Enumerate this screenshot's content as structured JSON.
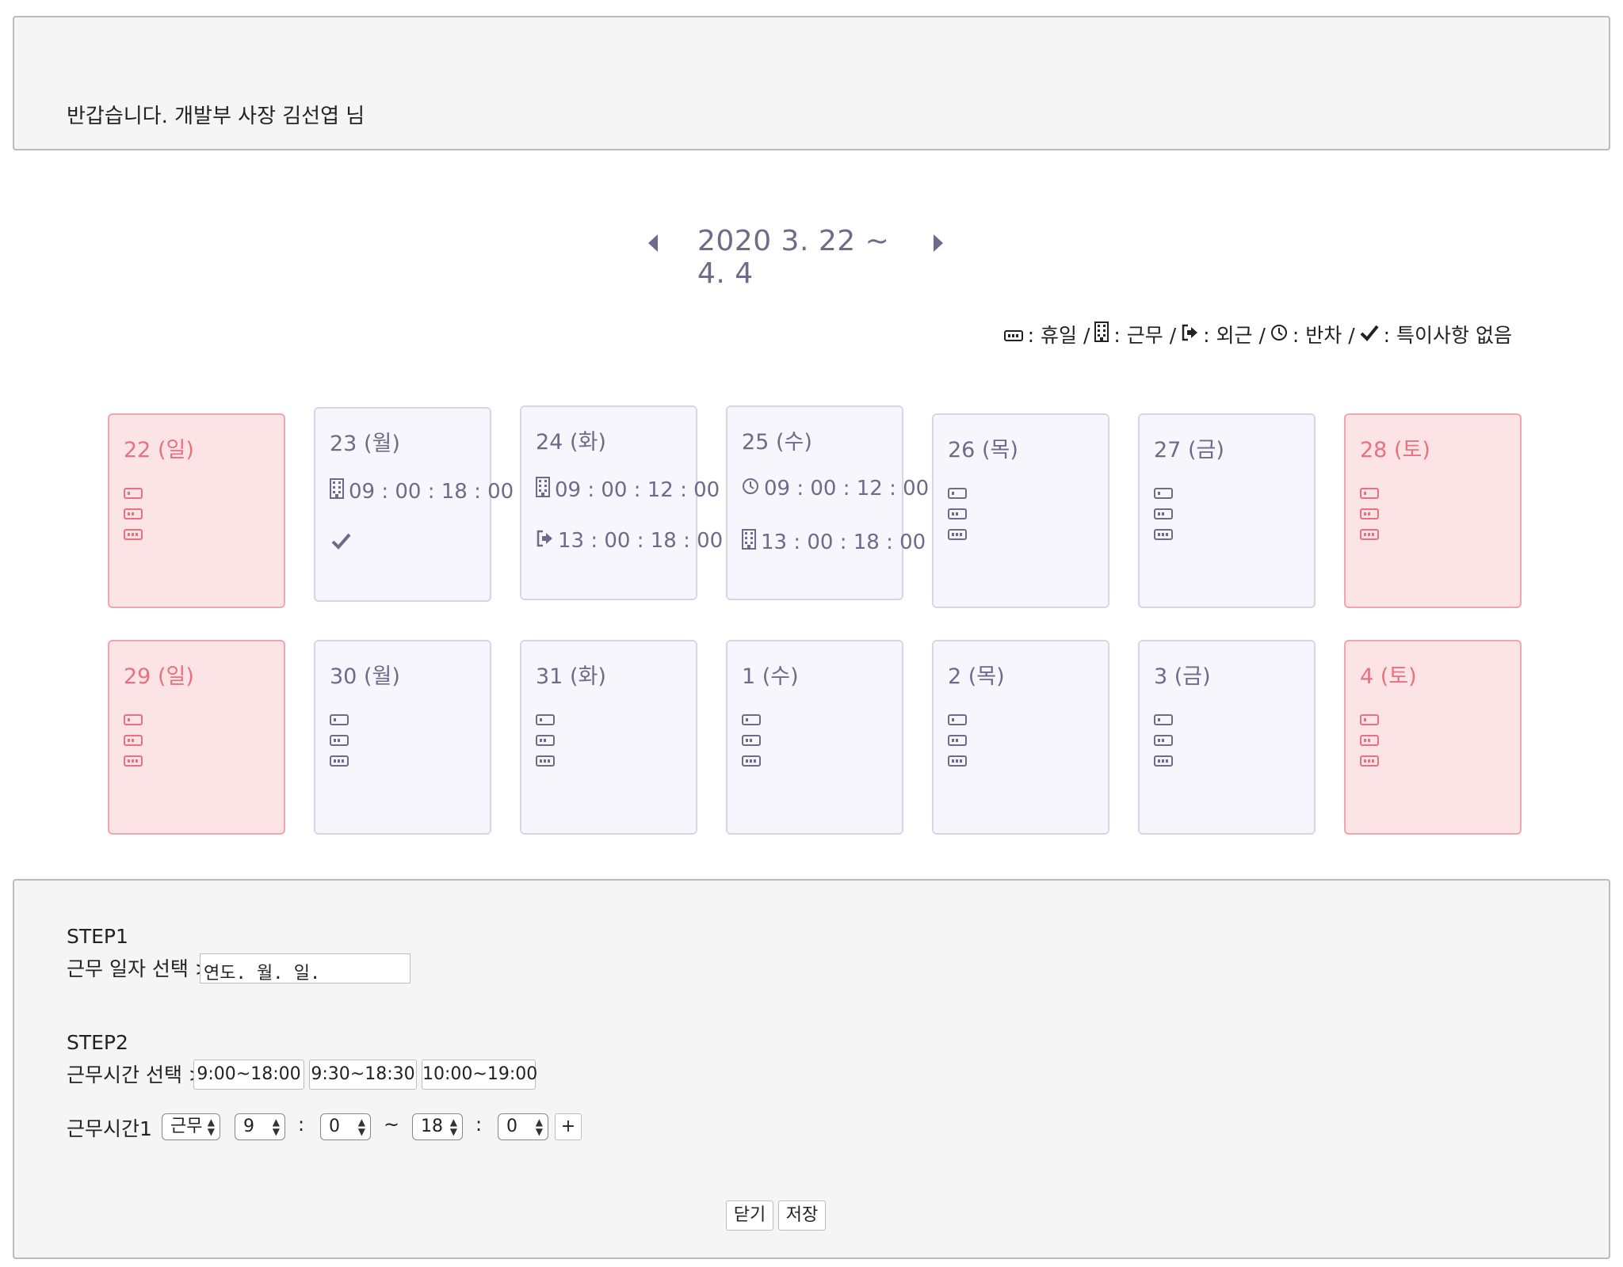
{
  "header": {
    "greeting": "반갑습니다. 개발부 사장 김선엽 님"
  },
  "nav": {
    "range": "2020 3. 22 ~ 4. 4"
  },
  "legend": {
    "items": [
      {
        "icon": "rest-icon",
        "label": ": 휴일 /"
      },
      {
        "icon": "building-icon",
        "label": ": 근무 /"
      },
      {
        "icon": "exit-icon",
        "label": ": 외근 /"
      },
      {
        "icon": "clock-icon",
        "label": ": 반차 /"
      },
      {
        "icon": "check-icon",
        "label": ": 특이사항 없음"
      }
    ]
  },
  "calendar": {
    "week1": [
      {
        "date": "22 (일)",
        "weekend": true
      },
      {
        "date": "23 (월)",
        "weekend": false,
        "entries": [
          {
            "icon": "building-icon",
            "time": "09 : 00 : 18 : 00"
          }
        ],
        "check": true
      },
      {
        "date": "24 (화)",
        "weekend": false,
        "entries": [
          {
            "icon": "building-icon",
            "time": "09 : 00 : 12 : 00"
          },
          {
            "icon": "exit-icon",
            "time": "13 : 00 : 18 : 00"
          }
        ]
      },
      {
        "date": "25 (수)",
        "weekend": false,
        "entries": [
          {
            "icon": "clock-icon",
            "time": "09 : 00 : 12 : 00"
          },
          {
            "icon": "building-icon",
            "time": "13 : 00 : 18 : 00"
          }
        ]
      },
      {
        "date": "26 (목)",
        "weekend": false
      },
      {
        "date": "27 (금)",
        "weekend": false
      },
      {
        "date": "28 (토)",
        "weekend": true
      }
    ],
    "week2": [
      {
        "date": "29 (일)",
        "weekend": true
      },
      {
        "date": "30 (월)",
        "weekend": false
      },
      {
        "date": "31 (화)",
        "weekend": false
      },
      {
        "date": "1 (수)",
        "weekend": false
      },
      {
        "date": "2 (목)",
        "weekend": false
      },
      {
        "date": "3 (금)",
        "weekend": false
      },
      {
        "date": "4 (토)",
        "weekend": true
      }
    ]
  },
  "form": {
    "step1_title": "STEP1",
    "step1_label": "근무 일자 선택 >",
    "date_input_value": "연도. 월. 일.",
    "step2_title": "STEP2",
    "step2_label": "근무시간 선택 >",
    "presets": [
      "9:00~18:00",
      "9:30~18:30",
      "10:00~19:00"
    ],
    "time_row_label": "근무시간1",
    "type_select": "근무",
    "start_hour": "9",
    "start_min": "0",
    "tilde": "~",
    "end_hour": "18",
    "end_min": "0",
    "colon": ":",
    "add_label": "+",
    "close_label": "닫기",
    "save_label": "저장"
  },
  "colors": {
    "accent": "#6e6a8a",
    "weekend_bg": "#fbe3e6",
    "weekend_text": "#e8707f",
    "weekday_bg": "#f7f6fd",
    "panel_bg": "#f5f5f5"
  }
}
